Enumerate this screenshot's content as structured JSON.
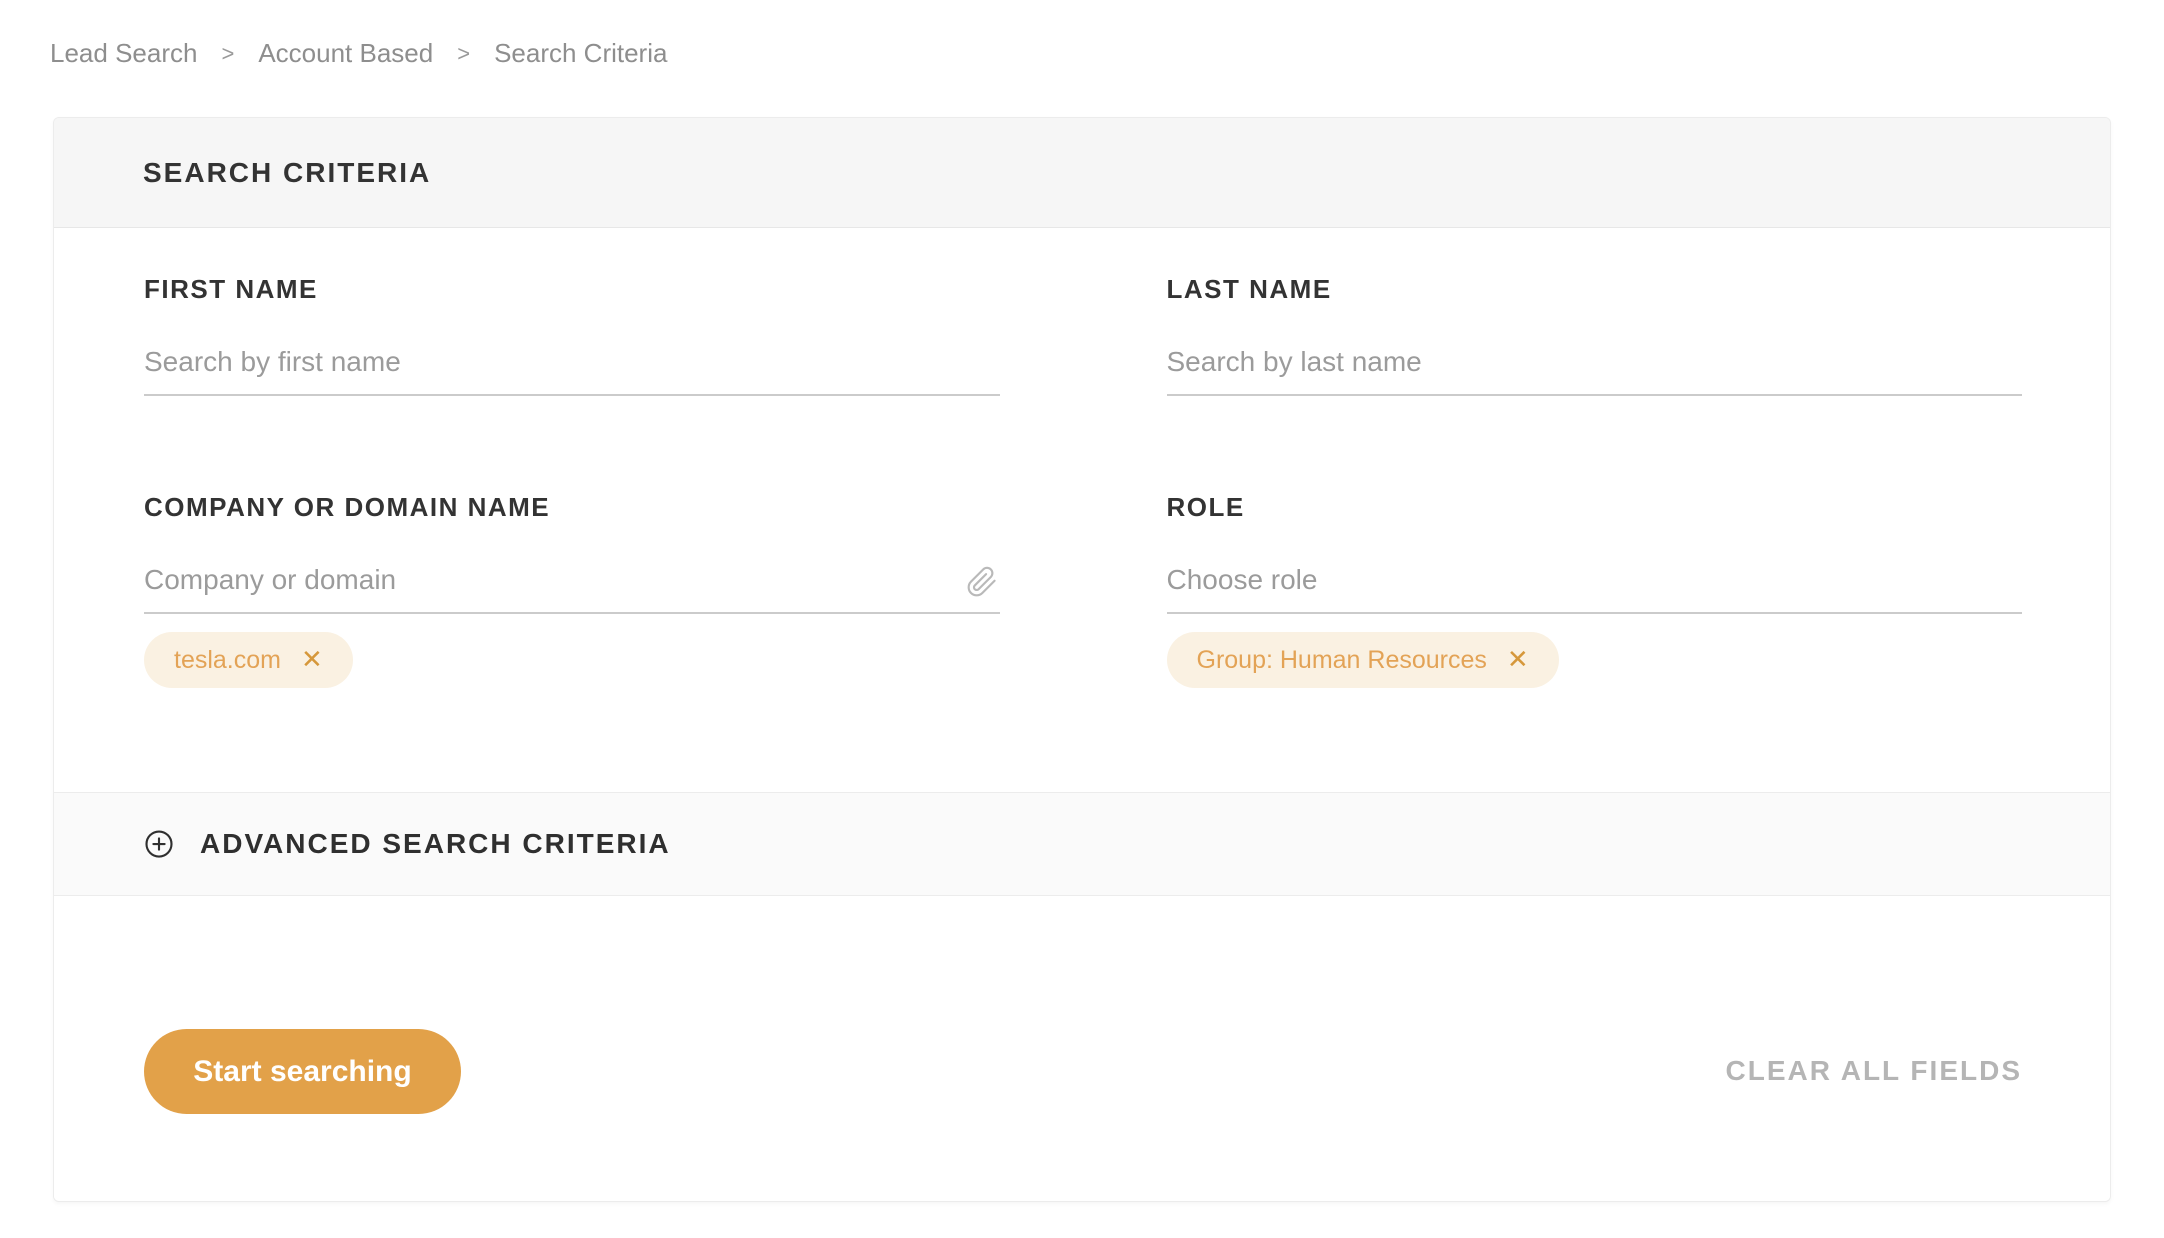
{
  "breadcrumb": {
    "separator": ">",
    "items": [
      {
        "label": "Lead Search"
      },
      {
        "label": "Account Based"
      },
      {
        "label": "Search Criteria"
      }
    ]
  },
  "panel": {
    "header_title": "SEARCH CRITERIA",
    "fields": {
      "first_name": {
        "label": "FIRST NAME",
        "placeholder": "Search by first name",
        "value": ""
      },
      "last_name": {
        "label": "LAST NAME",
        "placeholder": "Search by last name",
        "value": ""
      },
      "company": {
        "label": "COMPANY OR DOMAIN NAME",
        "placeholder": "Company or domain",
        "value": "",
        "chip": {
          "label": "tesla.com"
        }
      },
      "role": {
        "label": "ROLE",
        "placeholder": "Choose role",
        "value": "",
        "chip": {
          "label": "Group: Human Resources"
        }
      }
    },
    "icons": {
      "chip_remove": "✕",
      "company_attachment": "paperclip",
      "advanced_toggle": "plus-circle"
    },
    "advanced": {
      "label": "ADVANCED SEARCH CRITERIA"
    },
    "actions": {
      "start_label": "Start searching",
      "clear_label": "CLEAR ALL FIELDS"
    }
  },
  "colors": {
    "accent": "#e2a149",
    "chip_background": "#faf1e2",
    "chip_text": "#e3a356",
    "chip_remove": "#d6983b",
    "header_bar": "#f6f6f6",
    "advanced_bar": "#fafafa",
    "underline": "#cbcbcb",
    "label_text": "#333333",
    "muted_text": "#9b9b9b"
  }
}
